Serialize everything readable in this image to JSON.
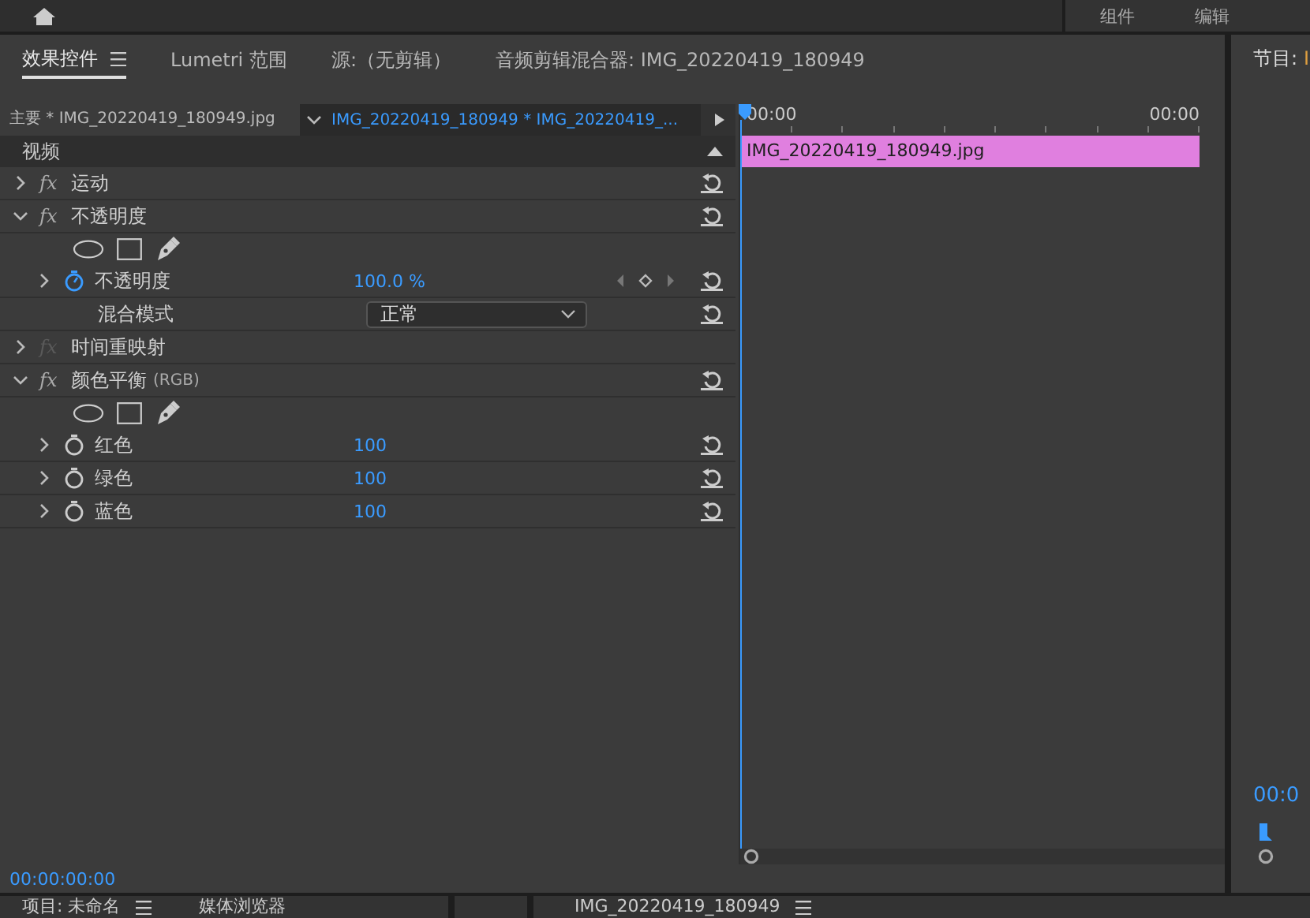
{
  "top_bar": {
    "workspaces": [
      {
        "label": "组件",
        "selected": false
      },
      {
        "label": "编辑",
        "selected": false
      }
    ]
  },
  "effect_panel": {
    "tabs": [
      {
        "label": "效果控件",
        "selected": true,
        "menu": true
      },
      {
        "label": "Lumetri 范围",
        "selected": false,
        "menu": false
      },
      {
        "label": "源:（无剪辑）",
        "selected": false,
        "menu": false
      },
      {
        "label": "音频剪辑混合器: IMG_20220419_180949",
        "selected": false,
        "menu": false
      }
    ],
    "master_clip": "主要 * IMG_20220419_180949.jpg",
    "sequence_clip": "IMG_20220419_180949 * IMG_20220419_...",
    "section": "视频",
    "rows": [
      {
        "kind": "effect",
        "badge": "fx",
        "label": "运动",
        "expanded": false,
        "enabled": true,
        "reset": true
      },
      {
        "kind": "effect",
        "badge": "fx",
        "label": "不透明度",
        "expanded": true,
        "enabled": true,
        "reset": true
      },
      {
        "kind": "masks"
      },
      {
        "kind": "param",
        "label": "不透明度",
        "value": "100.0 %",
        "animated": true,
        "keyframes": true,
        "expanded": false
      },
      {
        "kind": "dropdown",
        "label": "混合模式",
        "value": "正常"
      },
      {
        "kind": "effect",
        "badge": "fx",
        "label": "时间重映射",
        "expanded": false,
        "enabled": false,
        "reset": false
      },
      {
        "kind": "effect",
        "badge": "fx",
        "label": "颜色平衡",
        "suffix": "(RGB)",
        "expanded": true,
        "enabled": true,
        "reset": true
      },
      {
        "kind": "masks"
      },
      {
        "kind": "param",
        "label": "红色",
        "value": "100",
        "animated": false,
        "keyframes": false,
        "expanded": false
      },
      {
        "kind": "param",
        "label": "绿色",
        "value": "100",
        "animated": false,
        "keyframes": false,
        "expanded": false
      },
      {
        "kind": "param",
        "label": "蓝色",
        "value": "100",
        "animated": false,
        "keyframes": false,
        "expanded": false
      }
    ],
    "timecode": "00:00:00:00",
    "timeline": {
      "ruler": [
        "00:00",
        "00:00"
      ],
      "clip": "IMG_20220419_180949.jpg"
    }
  },
  "program_panel": {
    "title": "节目:",
    "clip": "I",
    "timecode": "00:0"
  },
  "bottom_tabs": [
    {
      "label": "项目: 未命名",
      "menu": true
    },
    {
      "label": "媒体浏览器",
      "menu": false
    },
    {
      "label": "IMG_20220419_180949",
      "menu": true
    }
  ]
}
